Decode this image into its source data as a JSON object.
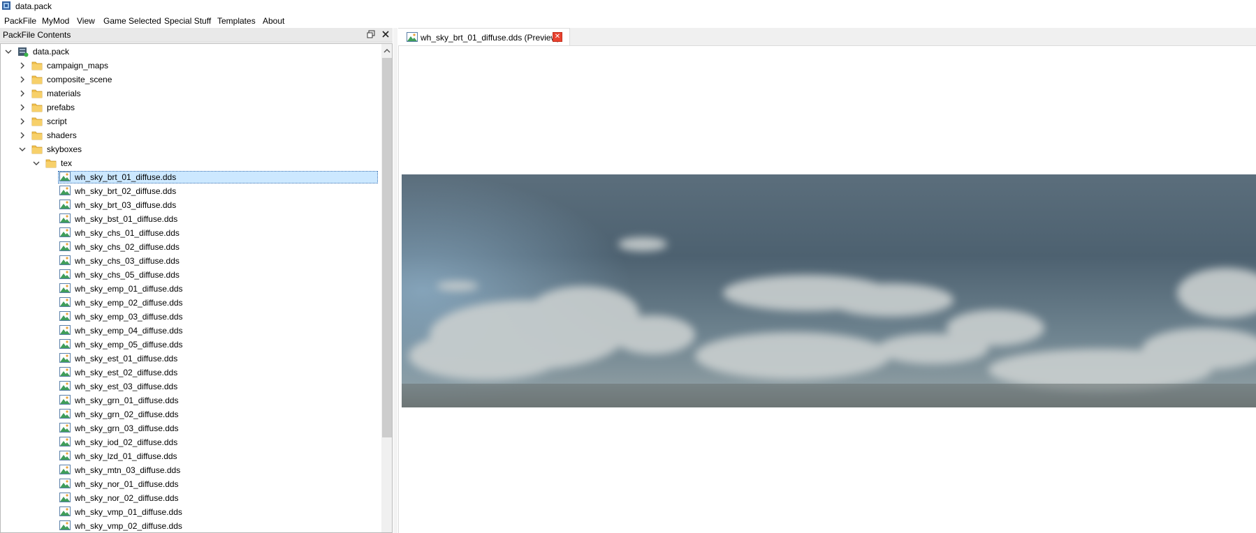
{
  "window": {
    "title": "data.pack"
  },
  "menu": [
    "PackFile",
    "MyMod",
    "View",
    "Game Selected",
    "Special Stuff",
    "Templates",
    "About"
  ],
  "dock": {
    "title": "PackFile Contents",
    "float_icon": "float-icon",
    "close_icon": "close-icon"
  },
  "tree": {
    "root": "data.pack",
    "folders": [
      "campaign_maps",
      "composite_scene",
      "materials",
      "prefabs",
      "script",
      "shaders"
    ],
    "expanded_folder": "skyboxes",
    "subfolder": "tex",
    "selected_file": "wh_sky_brt_01_diffuse.dds",
    "files": [
      "wh_sky_brt_01_diffuse.dds",
      "wh_sky_brt_02_diffuse.dds",
      "wh_sky_brt_03_diffuse.dds",
      "wh_sky_bst_01_diffuse.dds",
      "wh_sky_chs_01_diffuse.dds",
      "wh_sky_chs_02_diffuse.dds",
      "wh_sky_chs_03_diffuse.dds",
      "wh_sky_chs_05_diffuse.dds",
      "wh_sky_emp_01_diffuse.dds",
      "wh_sky_emp_02_diffuse.dds",
      "wh_sky_emp_03_diffuse.dds",
      "wh_sky_emp_04_diffuse.dds",
      "wh_sky_emp_05_diffuse.dds",
      "wh_sky_est_01_diffuse.dds",
      "wh_sky_est_02_diffuse.dds",
      "wh_sky_est_03_diffuse.dds",
      "wh_sky_grn_01_diffuse.dds",
      "wh_sky_grn_02_diffuse.dds",
      "wh_sky_grn_03_diffuse.dds",
      "wh_sky_iod_02_diffuse.dds",
      "wh_sky_lzd_01_diffuse.dds",
      "wh_sky_mtn_03_diffuse.dds",
      "wh_sky_nor_01_diffuse.dds",
      "wh_sky_nor_02_diffuse.dds",
      "wh_sky_vmp_01_diffuse.dds",
      "wh_sky_vmp_02_diffuse.dds"
    ]
  },
  "tab": {
    "label": "wh_sky_brt_01_diffuse.dds (Preview)",
    "close": "✕"
  },
  "colors": {
    "selection": "#cce8ff",
    "folder": "#f2c14e",
    "tab_close": "#e8422f"
  }
}
